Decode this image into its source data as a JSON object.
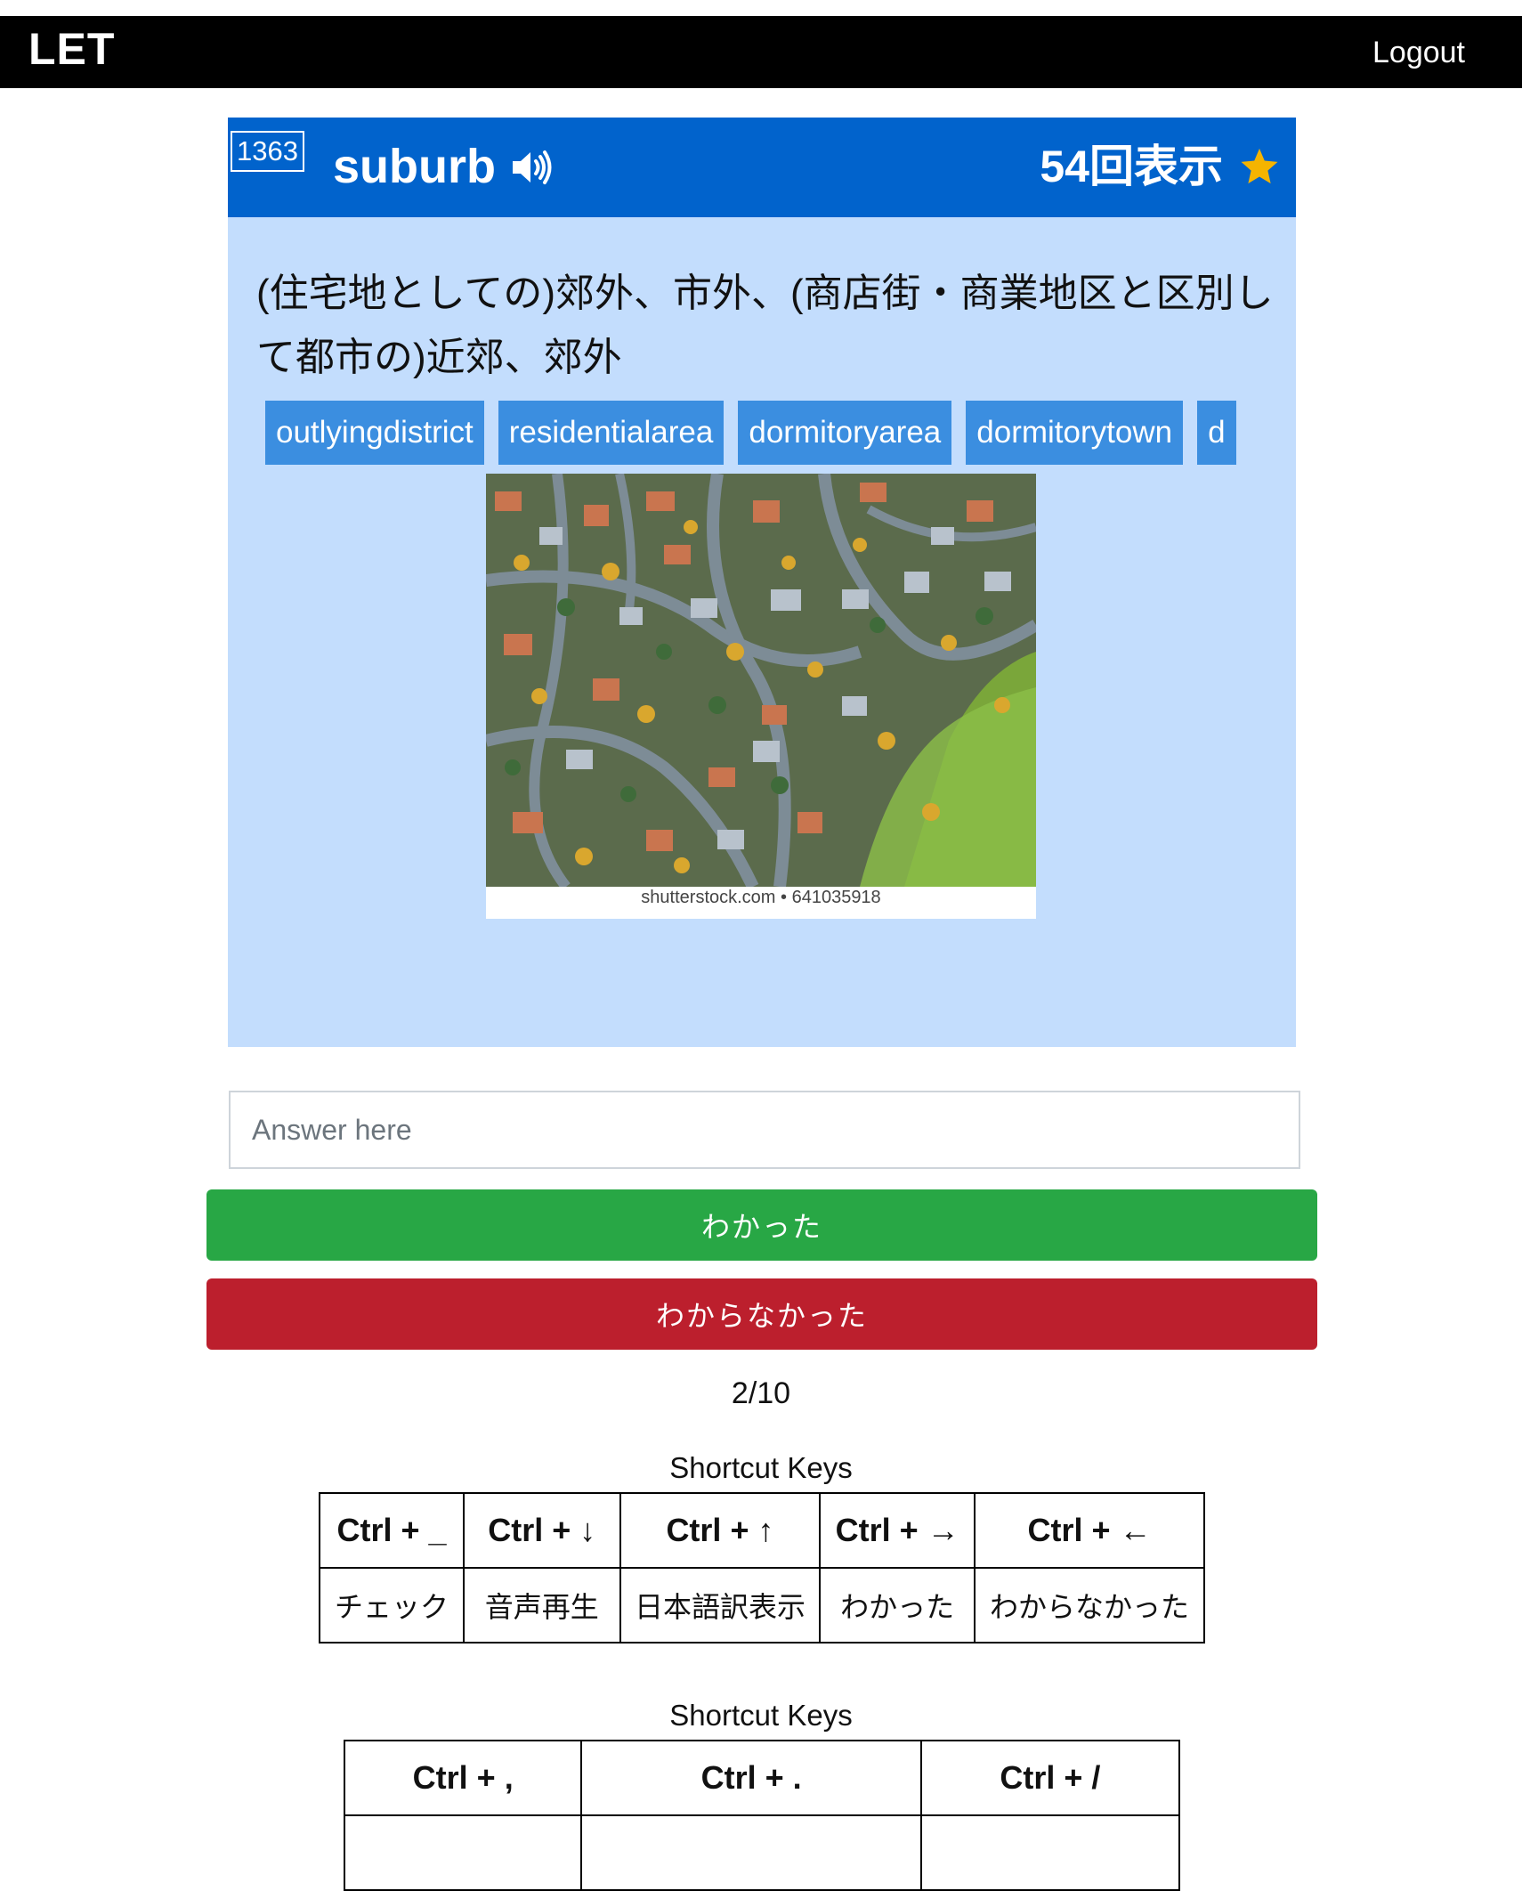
{
  "navbar": {
    "brand": "LET",
    "logout_label": "Logout"
  },
  "card": {
    "word_id": "1363",
    "word": "suburb",
    "views_label": "54回表示",
    "meaning": "(住宅地としての)郊外、市外、(商店街・商業地区と区別して都市の)近郊、郊外",
    "tags": [
      "outlyingdistrict",
      "residentialarea",
      "dormitoryarea",
      "dormitorytown",
      "d"
    ],
    "image_credit": "shutterstock.com • 641035918",
    "colors": {
      "header": "#0163cc",
      "body": "#c3ddfd",
      "tag": "#3b8ee0",
      "star": "#f5b400"
    }
  },
  "answer": {
    "placeholder": "Answer here",
    "value": ""
  },
  "buttons": {
    "ok_label": "わかった",
    "ng_label": "わからなかった"
  },
  "progress": "2/10",
  "shortcuts": [
    {
      "title": "Shortcut Keys",
      "keys": [
        "Ctrl + _",
        "Ctrl + ↓",
        "Ctrl + ↑",
        "Ctrl + →",
        "Ctrl + ←"
      ],
      "actions": [
        "チェック",
        "音声再生",
        "日本語訳表示",
        "わかった",
        "わからなかった"
      ]
    },
    {
      "title": "Shortcut Keys",
      "keys": [
        "Ctrl + ,",
        "Ctrl + .",
        "Ctrl + /"
      ],
      "actions": []
    }
  ]
}
